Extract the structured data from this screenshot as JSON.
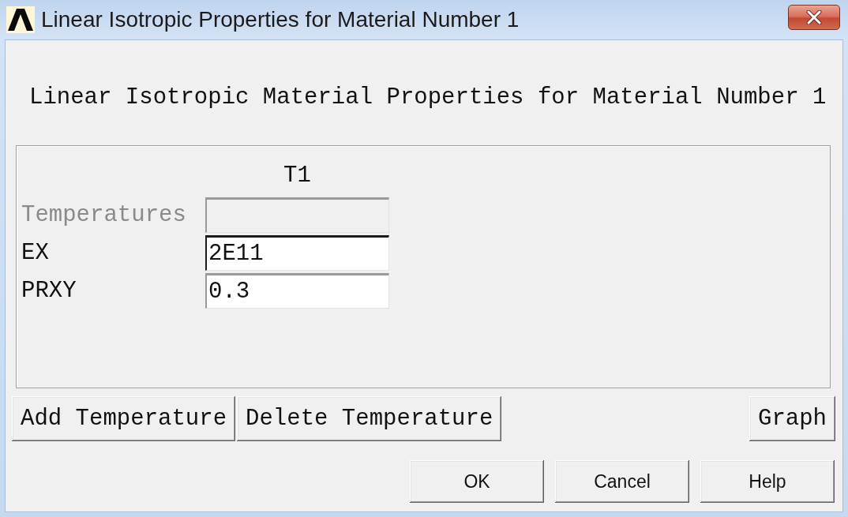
{
  "window": {
    "title": "Linear Isotropic Properties for Material Number 1"
  },
  "heading": "Linear Isotropic Material Properties for Material Number 1",
  "table": {
    "columns": [
      "T1"
    ],
    "rows": [
      {
        "label": "Temperatures",
        "disabled": true,
        "focused": false
      },
      {
        "label": "EX",
        "value": "2E11",
        "disabled": false,
        "focused": true
      },
      {
        "label": "PRXY",
        "value": "0.3",
        "disabled": false,
        "focused": false
      }
    ]
  },
  "temperature_buttons": [
    "Add Temperature",
    "Delete Temperature"
  ],
  "graph_button": "Graph",
  "dialog_buttons": [
    "OK",
    "Cancel",
    "Help"
  ]
}
